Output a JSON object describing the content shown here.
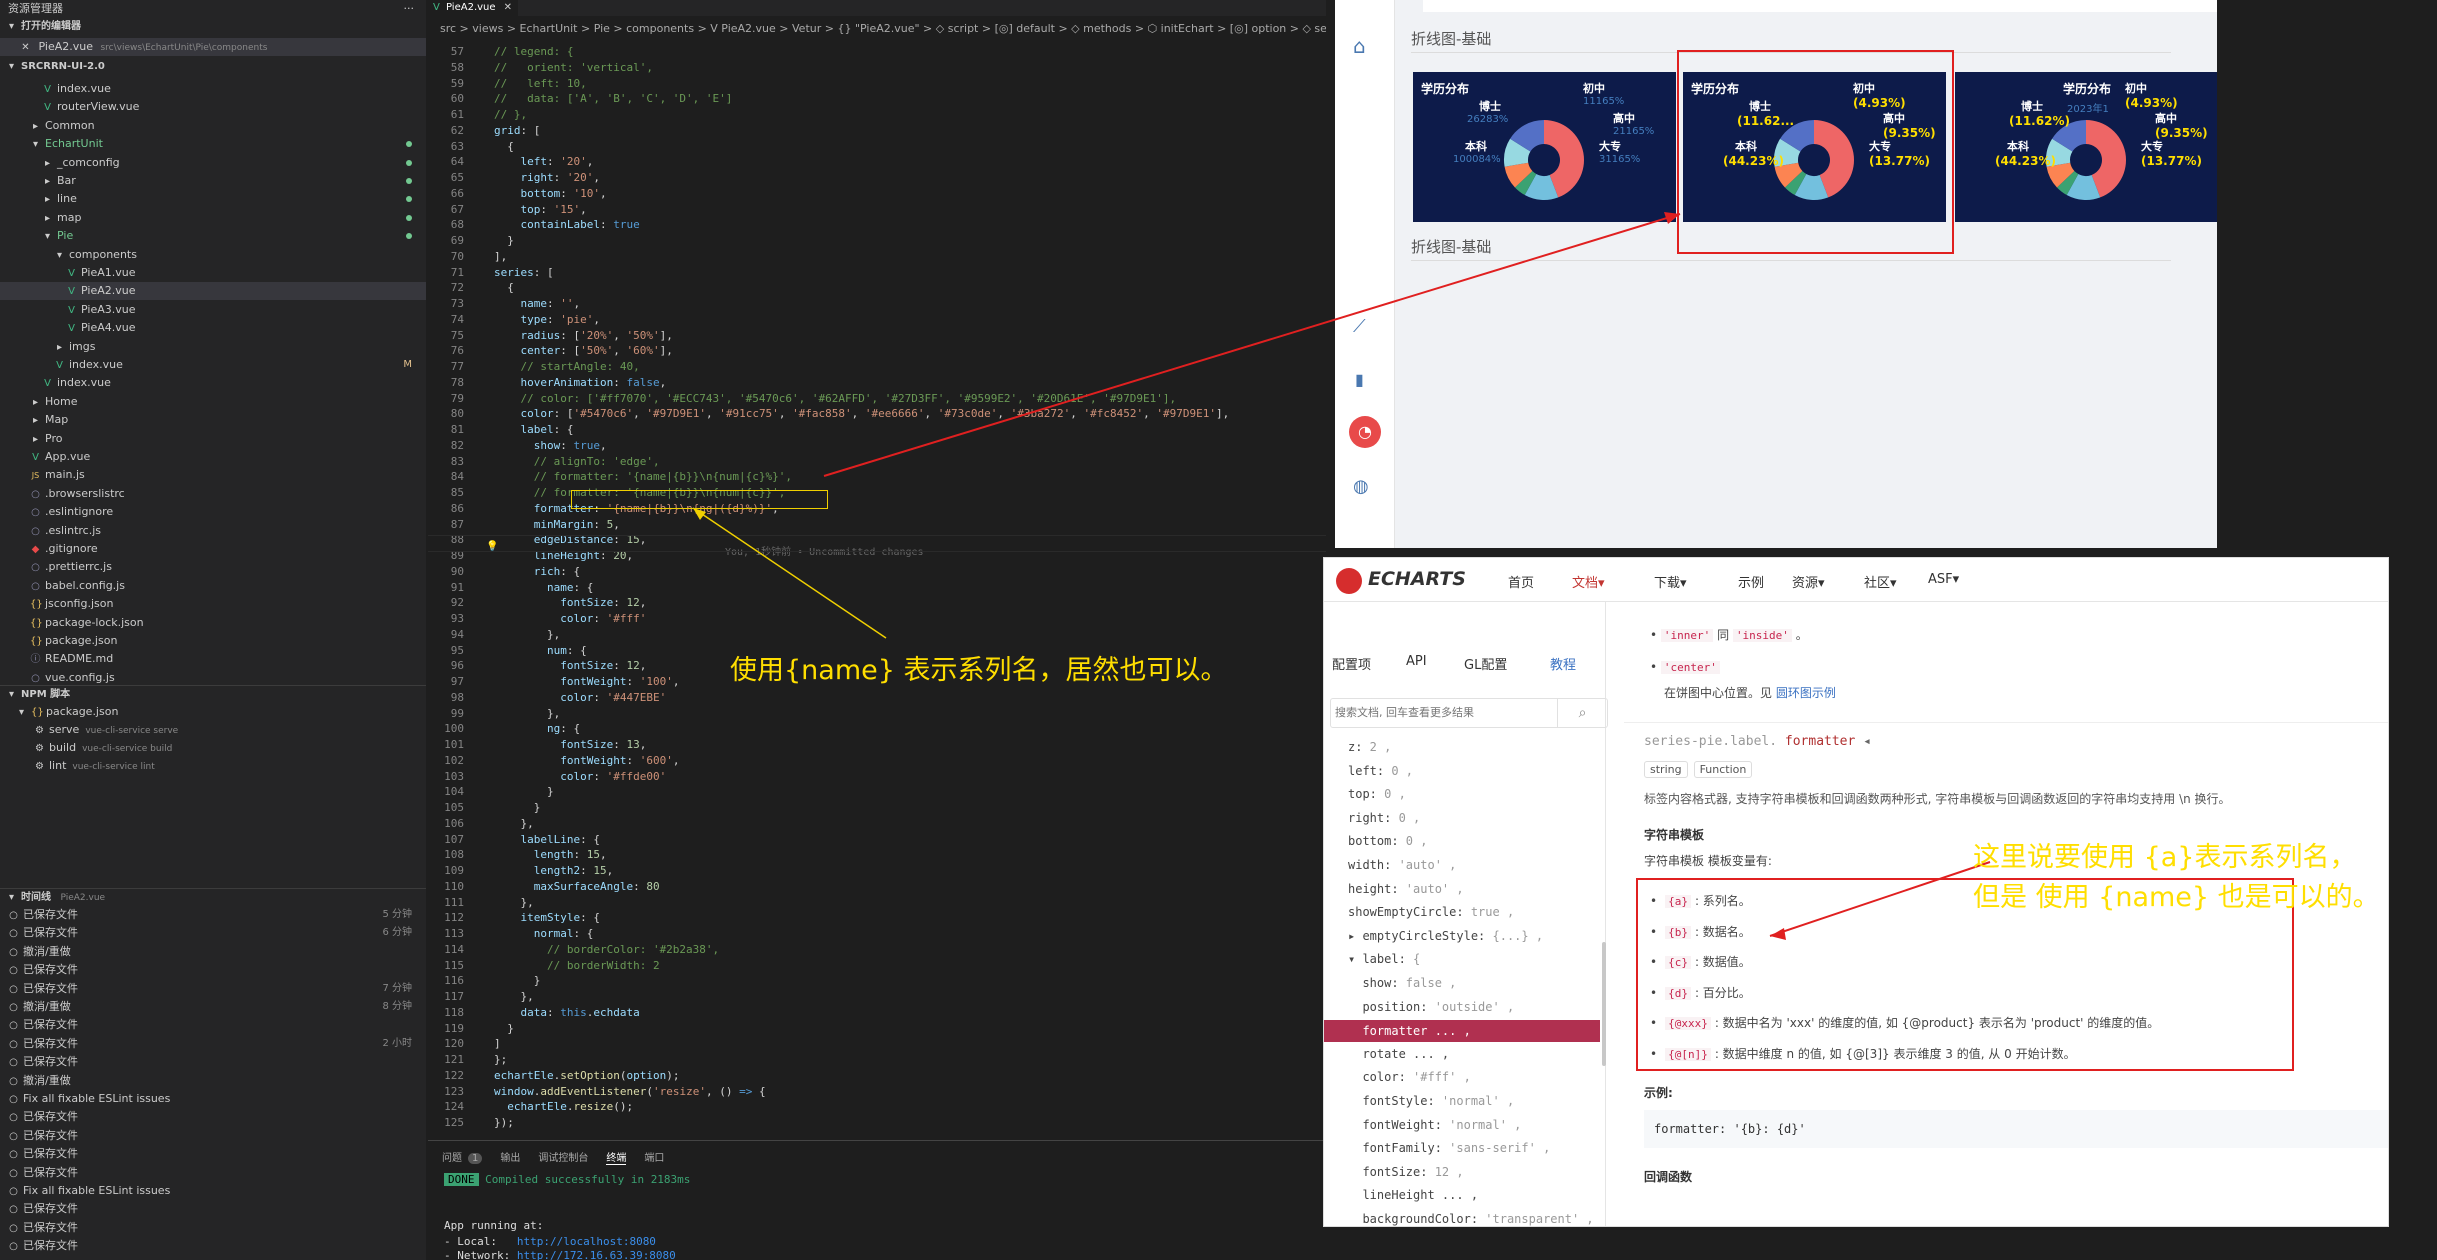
{
  "sidebar": {
    "header": "资源管理器",
    "dots": "···",
    "open_editors": "打开的编辑器",
    "open_file": "PieA2.vue",
    "open_file_path": "src\\views\\EchartUnit\\Pie\\components",
    "project": "SRCRRN-UI-2.0",
    "tree": [
      {
        "name": "index.vue",
        "indent": 40,
        "icon": "V"
      },
      {
        "name": "routerView.vue",
        "indent": 40,
        "icon": "V"
      },
      {
        "name": "Common",
        "indent": 28,
        "icon": "▸"
      },
      {
        "name": "EchartUnit",
        "indent": 28,
        "icon": "▾"
      },
      {
        "name": "_comconfig",
        "indent": 40,
        "icon": "▸"
      },
      {
        "name": "Bar",
        "indent": 40,
        "icon": "▸"
      },
      {
        "name": "line",
        "indent": 40,
        "icon": "▸"
      },
      {
        "name": "map",
        "indent": 40,
        "icon": "▸"
      },
      {
        "name": "Pie",
        "indent": 40,
        "icon": "▾"
      },
      {
        "name": "components",
        "indent": 52,
        "icon": "▾"
      },
      {
        "name": "PieA1.vue",
        "indent": 64,
        "icon": "V"
      },
      {
        "name": "PieA2.vue",
        "indent": 64,
        "icon": "V"
      },
      {
        "name": "PieA3.vue",
        "indent": 64,
        "icon": "V"
      },
      {
        "name": "PieA4.vue",
        "indent": 64,
        "icon": "V"
      },
      {
        "name": "imgs",
        "indent": 52,
        "icon": "▸"
      },
      {
        "name": "index.vue",
        "indent": 52,
        "icon": "V"
      },
      {
        "name": "index.vue",
        "indent": 40,
        "icon": "V"
      },
      {
        "name": "Home",
        "indent": 28,
        "icon": "▸"
      },
      {
        "name": "Map",
        "indent": 28,
        "icon": "▸"
      },
      {
        "name": "Pro",
        "indent": 28,
        "icon": "▸"
      },
      {
        "name": "App.vue",
        "indent": 28,
        "icon": "V"
      },
      {
        "name": "main.js",
        "indent": 28,
        "icon": "JS"
      },
      {
        "name": ".browserslistrc",
        "indent": 28,
        "icon": "○"
      },
      {
        "name": ".eslintignore",
        "indent": 28,
        "icon": "○"
      },
      {
        "name": ".eslintrc.js",
        "indent": 28,
        "icon": "○"
      },
      {
        "name": ".gitignore",
        "indent": 28,
        "icon": "◆"
      },
      {
        "name": ".prettierrc.js",
        "indent": 28,
        "icon": "○"
      },
      {
        "name": "babel.config.js",
        "indent": 28,
        "icon": "○"
      },
      {
        "name": "jsconfig.json",
        "indent": 28,
        "icon": "{}"
      },
      {
        "name": "package-lock.json",
        "indent": 28,
        "icon": "{}"
      },
      {
        "name": "package.json",
        "indent": 28,
        "icon": "{}"
      },
      {
        "name": "README.md",
        "indent": 28,
        "icon": "ⓘ"
      },
      {
        "name": "vue.config.js",
        "indent": 28,
        "icon": "○"
      }
    ],
    "modified_marker": "M",
    "npm_header": "NPM 脚本",
    "npm_pkg": "package.json",
    "npm_scripts": [
      {
        "name": "serve",
        "cmd": "vue-cli-service serve"
      },
      {
        "name": "build",
        "cmd": "vue-cli-service build"
      },
      {
        "name": "lint",
        "cmd": "vue-cli-service lint"
      }
    ],
    "timeline_header": "时间线",
    "timeline_file": "PieA2.vue",
    "timeline": [
      {
        "t": "已保存文件",
        "time": "5 分钟"
      },
      {
        "t": "已保存文件",
        "time": "6 分钟"
      },
      {
        "t": "撤消/重做",
        "time": ""
      },
      {
        "t": "已保存文件",
        "time": ""
      },
      {
        "t": "已保存文件",
        "time": "7 分钟"
      },
      {
        "t": "撤消/重做",
        "time": "8 分钟"
      },
      {
        "t": "已保存文件",
        "time": ""
      },
      {
        "t": "已保存文件",
        "time": "2 小时"
      },
      {
        "t": "已保存文件",
        "time": ""
      },
      {
        "t": "撤消/重做",
        "time": ""
      },
      {
        "t": "Fix all fixable ESLint issues",
        "time": ""
      },
      {
        "t": "已保存文件",
        "time": ""
      },
      {
        "t": "已保存文件",
        "time": ""
      },
      {
        "t": "已保存文件",
        "time": ""
      },
      {
        "t": "已保存文件",
        "time": ""
      },
      {
        "t": "Fix all fixable ESLint issues",
        "time": ""
      },
      {
        "t": "已保存文件",
        "time": ""
      },
      {
        "t": "已保存文件",
        "time": ""
      },
      {
        "t": "已保存文件",
        "time": ""
      }
    ]
  },
  "editor": {
    "tab": "PieA2.vue",
    "breadcrumb": "src > views > EchartUnit > Pie > components > V PieA2.vue > Vetur > {} \"PieA2.vue\" > ◇ script > [◎] default > ◇ methods > ⬡ initEchart > [◎] option > ◇ series > ◇ label",
    "blame": "You, 1秒钟前 • Uncommitted changes"
  },
  "code": [
    {
      "n": "57",
      "h": "<span class=\"c\">// legend: {</span>"
    },
    {
      "n": "58",
      "h": "<span class=\"c\">//   orient: 'vertical',</span>"
    },
    {
      "n": "59",
      "h": "<span class=\"c\">//   left: 10,</span>"
    },
    {
      "n": "60",
      "h": "<span class=\"c\">//   data: ['A', 'B', 'C', 'D', 'E']</span>"
    },
    {
      "n": "61",
      "h": "<span class=\"c\">// },</span>"
    },
    {
      "n": "62",
      "h": "<span class=\"p\">grid</span><span class=\"t\">: [</span>"
    },
    {
      "n": "63",
      "h": "<span class=\"t\">  {</span>"
    },
    {
      "n": "64",
      "h": "<span class=\"p\">    left</span><span class=\"t\">: </span><span class=\"s\">'20'</span><span class=\"t\">,</span>"
    },
    {
      "n": "65",
      "h": "<span class=\"p\">    right</span><span class=\"t\">: </span><span class=\"s\">'20'</span><span class=\"t\">,</span>"
    },
    {
      "n": "66",
      "h": "<span class=\"p\">    bottom</span><span class=\"t\">: </span><span class=\"s\">'10'</span><span class=\"t\">,</span>"
    },
    {
      "n": "67",
      "h": "<span class=\"p\">    top</span><span class=\"t\">: </span><span class=\"s\">'15'</span><span class=\"t\">,</span>"
    },
    {
      "n": "68",
      "h": "<span class=\"p\">    containLabel</span><span class=\"t\">: </span><span class=\"b\">true</span>"
    },
    {
      "n": "69",
      "h": "<span class=\"t\">  }</span>"
    },
    {
      "n": "70",
      "h": "<span class=\"t\">],</span>"
    },
    {
      "n": "71",
      "h": "<span class=\"p\">series</span><span class=\"t\">: [</span>"
    },
    {
      "n": "72",
      "h": "<span class=\"t\">  {</span>"
    },
    {
      "n": "73",
      "h": "<span class=\"p\">    name</span><span class=\"t\">: </span><span class=\"s\">''</span><span class=\"t\">,</span>"
    },
    {
      "n": "74",
      "h": "<span class=\"p\">    type</span><span class=\"t\">: </span><span class=\"s\">'pie'</span><span class=\"t\">,</span>"
    },
    {
      "n": "75",
      "h": "<span class=\"p\">    radius</span><span class=\"t\">: [</span><span class=\"s\">'20%'</span><span class=\"t\">, </span><span class=\"s\">'50%'</span><span class=\"t\">],</span>"
    },
    {
      "n": "76",
      "h": "<span class=\"p\">    center</span><span class=\"t\">: [</span><span class=\"s\">'50%'</span><span class=\"t\">, </span><span class=\"s\">'60%'</span><span class=\"t\">],</span>"
    },
    {
      "n": "77",
      "h": "<span class=\"c\">    // startAngle: 40,</span>"
    },
    {
      "n": "78",
      "h": "<span class=\"p\">    hoverAnimation</span><span class=\"t\">: </span><span class=\"b\">false</span><span class=\"t\">,</span>"
    },
    {
      "n": "79",
      "h": "<span class=\"c\">    // color: ['#ff7070', '#ECC743', '#5470c6', '#62AFFD', '#27D3FF', '#9599E2', '#20D61E', '#97D9E1'],</span>"
    },
    {
      "n": "80",
      "h": "<span class=\"p\">    color</span><span class=\"t\">: [</span><span class=\"s\">'#5470c6'</span><span class=\"t\">, </span><span class=\"s\">'#97D9E1'</span><span class=\"t\">, </span><span class=\"s\">'#91cc75'</span><span class=\"t\">, </span><span class=\"s\">'#fac858'</span><span class=\"t\">, </span><span class=\"s\">'#ee6666'</span><span class=\"t\">, </span><span class=\"s\">'#73c0de'</span><span class=\"t\">, </span><span class=\"s\">'#3ba272'</span><span class=\"t\">, </span><span class=\"s\">'#fc8452'</span><span class=\"t\">, </span><span class=\"s\">'#97D9E1'</span><span class=\"t\">],</span>"
    },
    {
      "n": "81",
      "h": "<span class=\"p\">    label</span><span class=\"t\">: {</span>"
    },
    {
      "n": "82",
      "h": "<span class=\"p\">      show</span><span class=\"t\">: </span><span class=\"b\">true</span><span class=\"t\">,</span>"
    },
    {
      "n": "83",
      "h": "<span class=\"c\">      // alignTo: 'edge',</span>"
    },
    {
      "n": "84",
      "h": "<span class=\"c\">      // formatter: '{name|{b}}\\n{num|{c}%}',</span>"
    },
    {
      "n": "85",
      "h": "<span class=\"c\">      // formatter: '{name|{b}}\\n{num|{c}}',</span>"
    },
    {
      "n": "86",
      "h": "<span class=\"p\">      formatter</span><span class=\"t\">: </span><span class=\"s\">'{name|{b}}\\n{ng|({d}%)}'</span><span class=\"t\">,</span>"
    },
    {
      "n": "87",
      "h": "<span class=\"p\">      minMargin</span><span class=\"t\">: </span><span class=\"n\">5</span><span class=\"t\">,</span>"
    },
    {
      "n": "88",
      "h": "<span class=\"p\">      edgeDistance</span><span class=\"t\">: </span><span class=\"n\">15</span><span class=\"t\">,</span>"
    },
    {
      "n": "89",
      "h": "<span class=\"p\">      lineHeight</span><span class=\"t\">: </span><span class=\"n\">20</span><span class=\"t\">,</span>"
    },
    {
      "n": "90",
      "h": "<span class=\"p\">      rich</span><span class=\"t\">: {</span>"
    },
    {
      "n": "91",
      "h": "<span class=\"p\">        name</span><span class=\"t\">: {</span>"
    },
    {
      "n": "92",
      "h": "<span class=\"p\">          fontSize</span><span class=\"t\">: </span><span class=\"n\">12</span><span class=\"t\">,</span>"
    },
    {
      "n": "93",
      "h": "<span class=\"p\">          color</span><span class=\"t\">: </span><span class=\"s\">'#fff'</span>"
    },
    {
      "n": "94",
      "h": "<span class=\"t\">        },</span>"
    },
    {
      "n": "95",
      "h": "<span class=\"p\">        num</span><span class=\"t\">: {</span>"
    },
    {
      "n": "96",
      "h": "<span class=\"p\">          fontSize</span><span class=\"t\">: </span><span class=\"n\">12</span><span class=\"t\">,</span>"
    },
    {
      "n": "97",
      "h": "<span class=\"p\">          fontWeight</span><span class=\"t\">: </span><span class=\"s\">'100'</span><span class=\"t\">,</span>"
    },
    {
      "n": "98",
      "h": "<span class=\"p\">          color</span><span class=\"t\">: </span><span class=\"s\">'#447EBE'</span>"
    },
    {
      "n": "99",
      "h": "<span class=\"t\">        },</span>"
    },
    {
      "n": "100",
      "h": "<span class=\"p\">        ng</span><span class=\"t\">: {</span>"
    },
    {
      "n": "101",
      "h": "<span class=\"p\">          fontSize</span><span class=\"t\">: </span><span class=\"n\">13</span><span class=\"t\">,</span>"
    },
    {
      "n": "102",
      "h": "<span class=\"p\">          fontWeight</span><span class=\"t\">: </span><span class=\"s\">'600'</span><span class=\"t\">,</span>"
    },
    {
      "n": "103",
      "h": "<span class=\"p\">          color</span><span class=\"t\">: </span><span class=\"s\">'#ffde00'</span>"
    },
    {
      "n": "104",
      "h": "<span class=\"t\">        }</span>"
    },
    {
      "n": "105",
      "h": "<span class=\"t\">      }</span>"
    },
    {
      "n": "106",
      "h": "<span class=\"t\">    },</span>"
    },
    {
      "n": "107",
      "h": "<span class=\"p\">    labelLine</span><span class=\"t\">: {</span>"
    },
    {
      "n": "108",
      "h": "<span class=\"p\">      length</span><span class=\"t\">: </span><span class=\"n\">15</span><span class=\"t\">,</span>"
    },
    {
      "n": "109",
      "h": "<span class=\"p\">      length2</span><span class=\"t\">: </span><span class=\"n\">15</span><span class=\"t\">,</span>"
    },
    {
      "n": "110",
      "h": "<span class=\"p\">      maxSurfaceAngle</span><span class=\"t\">: </span><span class=\"n\">80</span>"
    },
    {
      "n": "111",
      "h": "<span class=\"t\">    },</span>"
    },
    {
      "n": "112",
      "h": "<span class=\"p\">    itemStyle</span><span class=\"t\">: {</span>"
    },
    {
      "n": "113",
      "h": "<span class=\"p\">      normal</span><span class=\"t\">: {</span>"
    },
    {
      "n": "114",
      "h": "<span class=\"c\">        // borderColor: '#2b2a38',</span>"
    },
    {
      "n": "115",
      "h": "<span class=\"c\">        // borderWidth: 2</span>"
    },
    {
      "n": "116",
      "h": "<span class=\"t\">      }</span>"
    },
    {
      "n": "117",
      "h": "<span class=\"t\">    },</span>"
    },
    {
      "n": "118",
      "h": "<span class=\"p\">    data</span><span class=\"t\">: </span><span class=\"b\">this</span><span class=\"t\">.</span><span class=\"p\">echdata</span>"
    },
    {
      "n": "119",
      "h": "<span class=\"t\">  }</span>"
    },
    {
      "n": "120",
      "h": "<span class=\"t\">]</span>"
    },
    {
      "n": "121",
      "h": "<span class=\"t\">};</span>"
    },
    {
      "n": "122",
      "h": "<span class=\"p\">echartEle</span><span class=\"t\">.</span><span class=\"f\">setOption</span><span class=\"t\">(</span><span class=\"p\">option</span><span class=\"t\">);</span>"
    },
    {
      "n": "123",
      "h": "<span class=\"p\">window</span><span class=\"t\">.</span><span class=\"f\">addEventListener</span><span class=\"t\">(</span><span class=\"s\">'resize'</span><span class=\"t\">, () </span><span class=\"b\">=&gt;</span><span class=\"t\"> {</span>"
    },
    {
      "n": "124",
      "h": "<span class=\"p\">  echartEle</span><span class=\"t\">.</span><span class=\"f\">resize</span><span class=\"t\">();</span>"
    },
    {
      "n": "125",
      "h": "<span class=\"t\">});</span>"
    }
  ],
  "terminal": {
    "tabs": [
      "问题",
      "输出",
      "调试控制台",
      "终端",
      "端口"
    ],
    "badge": "1",
    "done": "DONE",
    "compiled": "Compiled successfully in 2183ms",
    "running": "App running at:",
    "local_label": "- Local:   ",
    "local_url": "http://localhost:8080",
    "network_label": "- Network: ",
    "network_url": "http://172.16.63.39:8080"
  },
  "browser": {
    "section1": "折线图-基础",
    "section2": "折线图-基础",
    "icon_colors": [
      "#1f8aa8",
      "#e84a4a"
    ],
    "cards": [
      {
        "title": "学历分布",
        "labels": [
          "初中",
          "博士",
          "高中",
          "本科",
          "大专"
        ],
        "values": [
          "11165%",
          "26283%",
          "21165%",
          "100084%",
          "31165%"
        ],
        "mode": "value"
      },
      {
        "title": "学历分布",
        "labels": [
          "初中",
          "博士",
          "高中",
          "本科",
          "大专"
        ],
        "values": [
          "(4.93%)",
          "(11.62...",
          "(9.35%)",
          "(44.23%)",
          "(13.77%)"
        ],
        "mode": "pct"
      },
      {
        "title": "学历分布",
        "labels": [
          "初中",
          "博士",
          "高中",
          "本科",
          "大专"
        ],
        "values": [
          "(4.93%)",
          "(11.62%)",
          "(9.35%)",
          "(44.23%)",
          "(13.77%)"
        ],
        "mode": "pct",
        "overlay": "2023年1"
      }
    ]
  },
  "chart_data": {
    "type": "pie",
    "categories": [
      "本科",
      "大专",
      "初中",
      "高中",
      "博士"
    ],
    "values": [
      44.23,
      13.77,
      4.93,
      9.35,
      11.62
    ],
    "colors": [
      "#5470c6",
      "#97D9E1",
      "#91cc75",
      "#fac858",
      "#ee6666",
      "#73c0de",
      "#3ba272",
      "#fc8452",
      "#97D9E1"
    ]
  },
  "doc": {
    "brand": "ECHARTS",
    "nav": [
      "首页",
      "文档▾",
      "下载▾",
      "示例",
      "资源▾",
      "社区▾",
      "ASF▾"
    ],
    "tabs": [
      "配置项",
      "API",
      "GL配置",
      "教程"
    ],
    "search_placeholder": "搜索文档, 回车查看更多结果",
    "tree": [
      {
        "k": "z:",
        "v": " 2 ,"
      },
      {
        "k": "left:",
        "v": " 0 ,"
      },
      {
        "k": "top:",
        "v": " 0 ,"
      },
      {
        "k": "right:",
        "v": " 0 ,"
      },
      {
        "k": "bottom:",
        "v": " 0 ,"
      },
      {
        "k": "width:",
        "v": " 'auto' ,"
      },
      {
        "k": "height:",
        "v": " 'auto' ,"
      },
      {
        "k": "showEmptyCircle:",
        "v": " true ,"
      },
      {
        "k": "▸ emptyCircleStyle:",
        "v": " {...} ,"
      },
      {
        "k": "▾ label:",
        "v": " {"
      },
      {
        "k": "  show:",
        "v": " false ,"
      },
      {
        "k": "  position:",
        "v": " 'outside' ,"
      },
      {
        "k": "  formatter ... ,",
        "v": ""
      },
      {
        "k": "  rotate ... ,",
        "v": ""
      },
      {
        "k": "  color:",
        "v": " '#fff' ,"
      },
      {
        "k": "  fontStyle:",
        "v": " 'normal' ,"
      },
      {
        "k": "  fontWeight:",
        "v": " 'normal' ,"
      },
      {
        "k": "  fontFamily:",
        "v": " 'sans-serif' ,"
      },
      {
        "k": "  fontSize:",
        "v": " 12 ,"
      },
      {
        "k": "  lineHeight ... ,",
        "v": ""
      },
      {
        "k": "  backgroundColor:",
        "v": " 'transparent' ,"
      },
      {
        "k": "  borderColor ... ,",
        "v": ""
      },
      {
        "k": "  borderWidth:",
        "v": " 0 ,"
      }
    ],
    "inner": "'inner'",
    "same": "同",
    "inside": "'inside'",
    "center": "'center'",
    "center_desc": "在饼图中心位置。见",
    "center_link": "圆环图示例",
    "option_path": "series-pie.label.",
    "option_name": "formatter",
    "types": [
      "string",
      "Function"
    ],
    "desc": "标签内容格式器, 支持字符串模板和回调函数两种形式, 字符串模板与回调函数返回的字符串均支持用 \\n 换行。",
    "h_tpl": "字符串模板",
    "tpl_vars": "字符串模板 模板变量有:",
    "vars": [
      {
        "tok": "{a}",
        "d": ": 系列名。"
      },
      {
        "tok": "{b}",
        "d": ": 数据名。"
      },
      {
        "tok": "{c}",
        "d": ": 数据值。"
      },
      {
        "tok": "{d}",
        "d": ": 百分比。"
      },
      {
        "tok": "{@xxx}",
        "d": ": 数据中名为 'xxx' 的维度的值, 如 {@product} 表示名为 'product' 的维度的值。"
      },
      {
        "tok": "{@[n]}",
        "d": ": 数据中维度 n 的值, 如 {@[3]} 表示维度 3 的值, 从 0 开始计数。"
      }
    ],
    "example_h": "示例:",
    "example_code": "formatter: '{b}: {d}'",
    "callback_h": "回调函数"
  },
  "annotations": {
    "a1": "使用{name} 表示系列名，居然也可以。",
    "a2_line1": "这里说要使用 {a}表示系列名，",
    "a2_line2": "但是 使用 {name} 也是可以的。"
  }
}
